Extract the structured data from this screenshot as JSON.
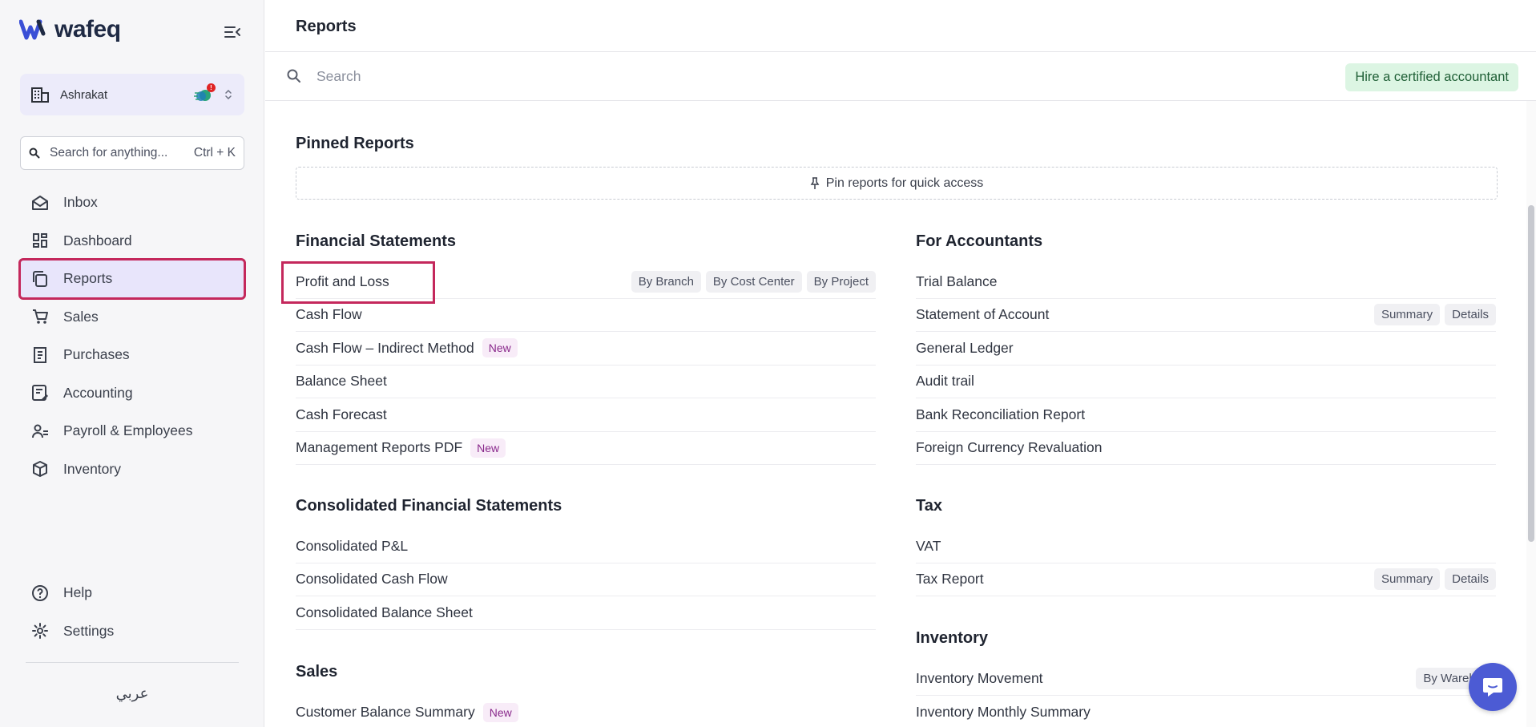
{
  "app": {
    "brand": "wafeq"
  },
  "sidebar": {
    "org_name": "Ashrakat",
    "org_badge": "!",
    "search_placeholder": "Search for anything...",
    "search_shortcut": "Ctrl + K",
    "items": [
      {
        "label": "Inbox",
        "icon": "inbox-icon"
      },
      {
        "label": "Dashboard",
        "icon": "dashboard-icon"
      },
      {
        "label": "Reports",
        "icon": "reports-icon",
        "active": true
      },
      {
        "label": "Sales",
        "icon": "cart-icon"
      },
      {
        "label": "Purchases",
        "icon": "receipt-icon"
      },
      {
        "label": "Accounting",
        "icon": "accounting-icon"
      },
      {
        "label": "Payroll & Employees",
        "icon": "people-icon"
      },
      {
        "label": "Inventory",
        "icon": "box-icon"
      }
    ],
    "bottom_items": [
      {
        "label": "Help",
        "icon": "help-icon"
      },
      {
        "label": "Settings",
        "icon": "gear-icon"
      }
    ],
    "language_toggle": "عربي"
  },
  "main": {
    "title": "Reports",
    "search_placeholder": "Search",
    "hire_button": "Hire a certified accountant",
    "pinned": {
      "heading": "Pinned Reports",
      "empty_text": "Pin reports for quick access"
    },
    "financial_statements": {
      "heading": "Financial Statements",
      "rows": [
        {
          "label": "Profit and Loss",
          "tags": [
            "By Branch",
            "By Cost Center",
            "By Project"
          ]
        },
        {
          "label": "Cash Flow"
        },
        {
          "label": "Cash Flow – Indirect Method",
          "badge": "New"
        },
        {
          "label": "Balance Sheet"
        },
        {
          "label": "Cash Forecast"
        },
        {
          "label": "Management Reports PDF",
          "badge": "New"
        }
      ]
    },
    "consolidated": {
      "heading": "Consolidated Financial Statements",
      "rows": [
        {
          "label": "Consolidated P&L"
        },
        {
          "label": "Consolidated Cash Flow"
        },
        {
          "label": "Consolidated Balance Sheet"
        }
      ]
    },
    "sales": {
      "heading": "Sales",
      "rows": [
        {
          "label": "Customer Balance Summary",
          "badge": "New"
        }
      ]
    },
    "for_accountants": {
      "heading": "For Accountants",
      "rows": [
        {
          "label": "Trial Balance"
        },
        {
          "label": "Statement of Account",
          "tags": [
            "Summary",
            "Details"
          ]
        },
        {
          "label": "General Ledger"
        },
        {
          "label": "Audit trail"
        },
        {
          "label": "Bank Reconciliation Report"
        },
        {
          "label": "Foreign Currency Revaluation"
        }
      ]
    },
    "tax": {
      "heading": "Tax",
      "rows": [
        {
          "label": "VAT"
        },
        {
          "label": "Tax Report",
          "tags": [
            "Summary",
            "Details"
          ]
        }
      ]
    },
    "inventory": {
      "heading": "Inventory",
      "rows": [
        {
          "label": "Inventory Movement",
          "tags": [
            "By Wareho"
          ]
        },
        {
          "label": "Inventory Monthly Summary"
        }
      ]
    }
  },
  "colors": {
    "accent": "#4c5bd4",
    "highlight": "#c4285c",
    "active_bg": "#e8e5fb",
    "hire_bg": "#dcf5e3"
  }
}
